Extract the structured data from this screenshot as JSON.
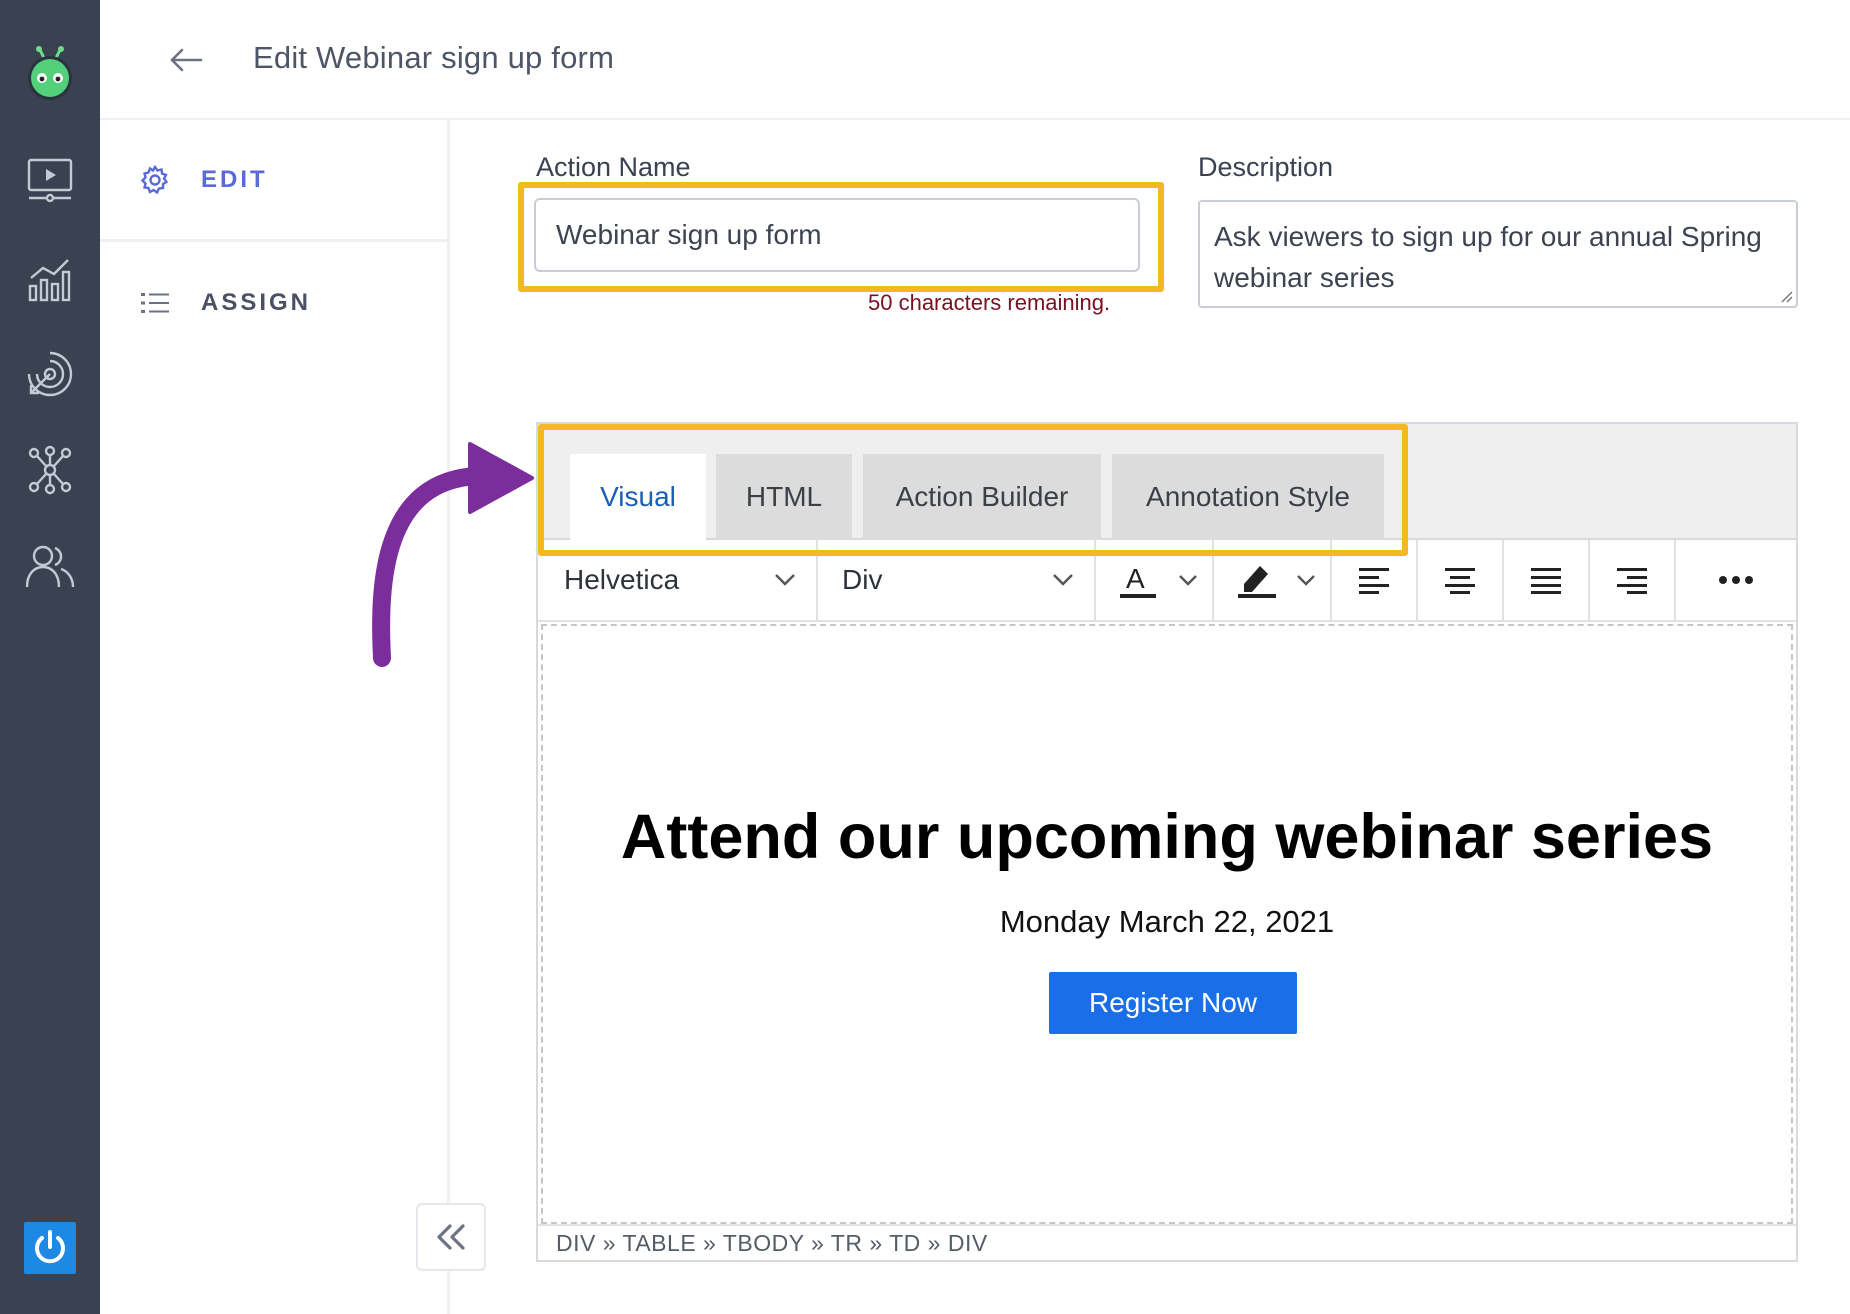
{
  "header": {
    "title": "Edit Webinar sign up form"
  },
  "subnav": {
    "items": [
      {
        "label": "EDIT",
        "icon": "gear-icon"
      },
      {
        "label": "ASSIGN",
        "icon": "list-icon"
      }
    ]
  },
  "form": {
    "action_name_label": "Action Name",
    "action_name_value": "Webinar sign up form",
    "chars_remaining": "50 characters remaining.",
    "description_label": "Description",
    "description_value": "Ask viewers to sign up for our annual Spring webinar series"
  },
  "editor": {
    "tabs": [
      {
        "label": "Visual",
        "active": true
      },
      {
        "label": "HTML",
        "active": false
      },
      {
        "label": "Action Builder",
        "active": false
      },
      {
        "label": "Annotation Style",
        "active": false
      }
    ],
    "toolbar": {
      "font_family": "Helvetica",
      "block_format": "Div"
    },
    "content": {
      "headline": "Attend our upcoming webinar series",
      "date": "Monday March 22, 2021",
      "button_label": "Register Now"
    },
    "path": "DIV » TABLE » TBODY » TR » TD » DIV"
  },
  "colors": {
    "rail": "#3a4252",
    "highlight": "#f4b920",
    "arrow": "#7b2d9b",
    "accent": "#5a6ad8",
    "button": "#1a6fe8"
  }
}
